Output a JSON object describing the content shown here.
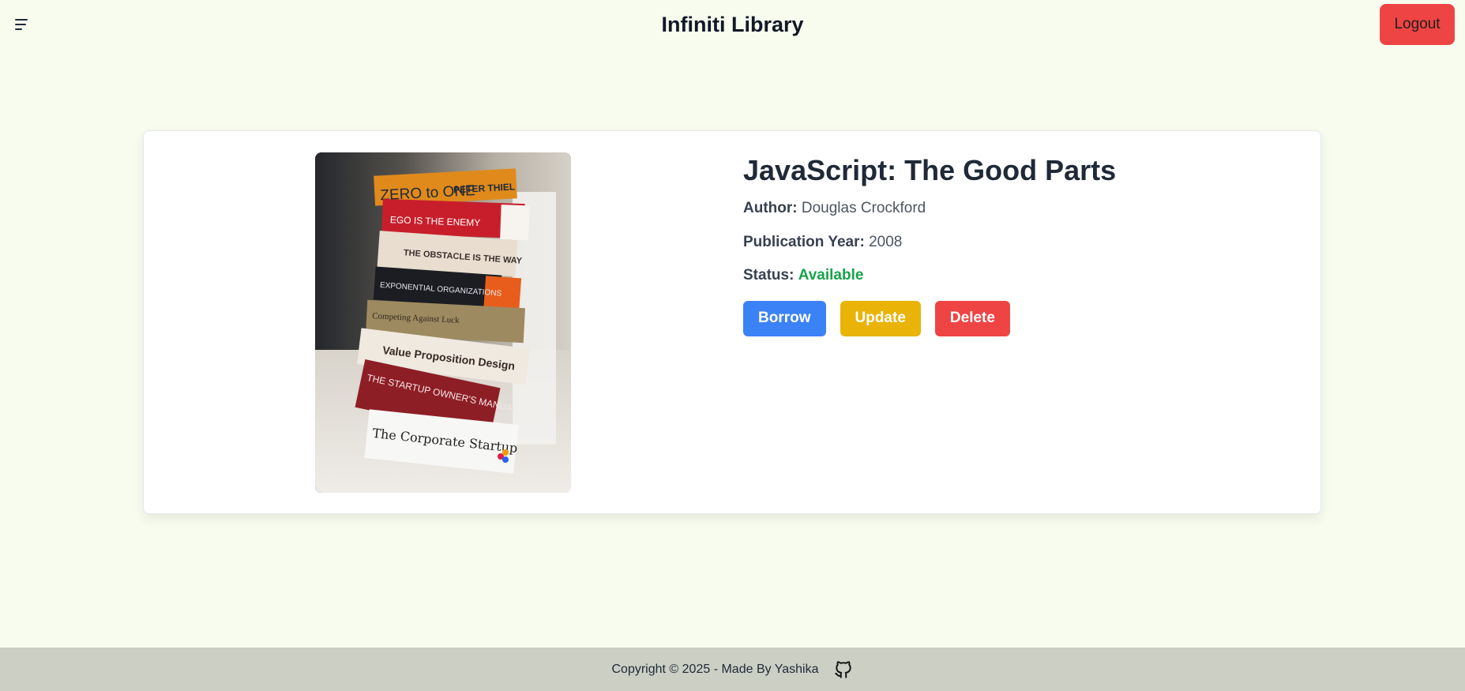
{
  "nav": {
    "title": "Infiniti Library",
    "logout_label": "Logout",
    "menu_icon": "hamburger-menu-icon"
  },
  "book": {
    "title": "JavaScript: The Good Parts",
    "author_label": "Author:",
    "author": "Douglas Crockford",
    "year_label": "Publication Year:",
    "year": "2008",
    "status_label": "Status:",
    "status": "Available",
    "image_alt": "stack of books",
    "spines": [
      "ZERO to ONE",
      "PETER THIEL",
      "EGO IS THE ENEMY",
      "THE OBSTACLE IS THE WAY",
      "EXPONENTIAL ORGANIZATIONS",
      "Competing Against Luck",
      "Value Proposition Design",
      "THE STARTUP OWNER'S MANUAL",
      "The Corporate Startup"
    ]
  },
  "actions": {
    "borrow": "Borrow",
    "update": "Update",
    "delete": "Delete"
  },
  "footer": {
    "text": "Copyright © 2025 - Made By Yashika",
    "icon": "github-icon"
  },
  "colors": {
    "background": "#f8fcee",
    "logout": "#ef4444",
    "borrow": "#3b82f6",
    "update": "#eab308",
    "delete": "#ef4444",
    "status_available": "#16a34a",
    "footer": "#cbcfc4"
  }
}
